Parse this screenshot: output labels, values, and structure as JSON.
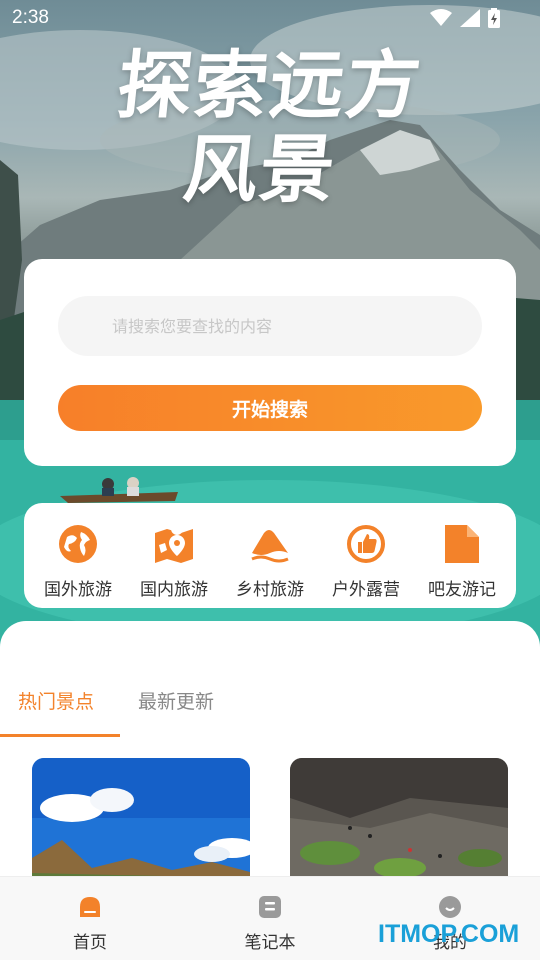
{
  "status_bar": {
    "time": "2:38"
  },
  "hero": {
    "title_line1": "探索远方",
    "title_line2": "风景"
  },
  "search": {
    "placeholder": "请搜索您要查找的内容",
    "button_label": "开始搜索"
  },
  "categories": [
    {
      "label": "国外旅游",
      "icon": "globe-icon"
    },
    {
      "label": "国内旅游",
      "icon": "map-pin-icon"
    },
    {
      "label": "乡村旅游",
      "icon": "mountain-icon"
    },
    {
      "label": "户外露营",
      "icon": "thumbs-up-icon"
    },
    {
      "label": "吧友游记",
      "icon": "document-icon"
    }
  ],
  "tabs": [
    {
      "label": "热门景点",
      "active": true
    },
    {
      "label": "最新更新",
      "active": false
    }
  ],
  "bottom_nav": [
    {
      "label": "首页",
      "icon": "home-icon",
      "active": true
    },
    {
      "label": "笔记本",
      "icon": "notebook-icon",
      "active": false
    },
    {
      "label": "我的",
      "icon": "profile-icon",
      "active": false
    }
  ],
  "watermark": "ITMOP.COM",
  "colors": {
    "accent": "#f3822a",
    "button_start": "#f77f29",
    "button_end": "#f99a2b"
  }
}
